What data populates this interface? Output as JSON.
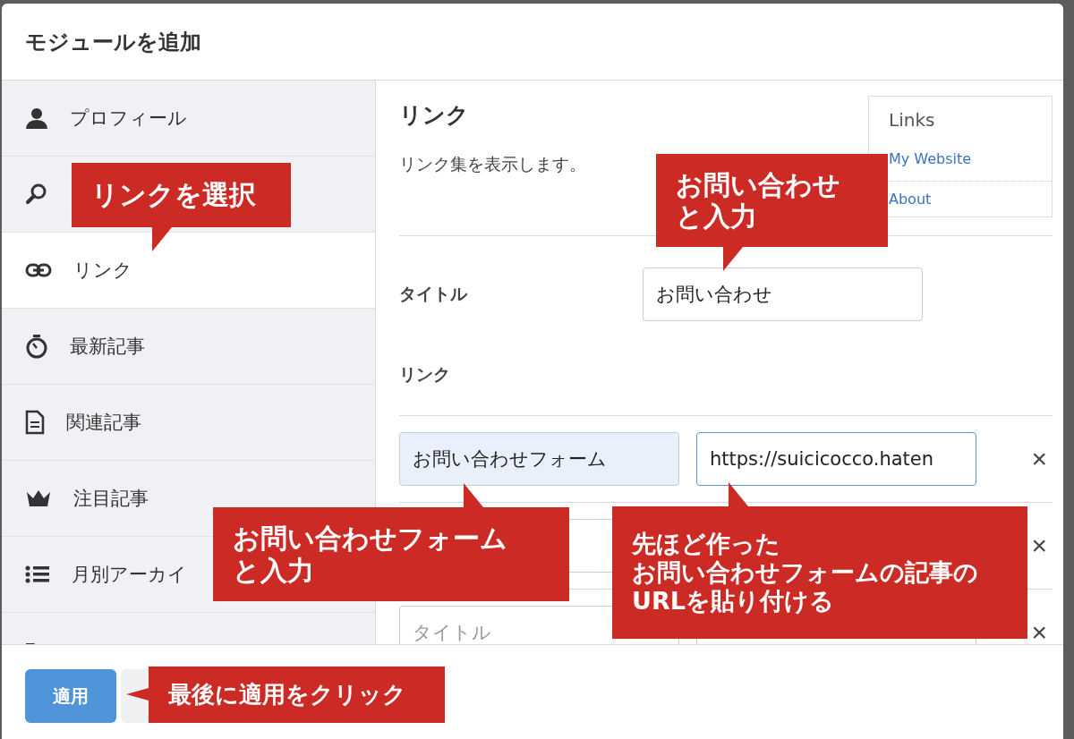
{
  "dialog": {
    "title": "モジュールを追加"
  },
  "sidebar": {
    "items": [
      {
        "label": "プロフィール",
        "selected": false
      },
      {
        "selected": false
      },
      {
        "label": "リンク",
        "selected": true
      },
      {
        "label": "最新記事",
        "selected": false
      },
      {
        "label": "関連記事",
        "selected": false
      },
      {
        "label": "注目記事",
        "selected": false
      },
      {
        "label": "月別アーカイ",
        "selected": false
      },
      {
        "selected": false
      }
    ]
  },
  "module": {
    "title": "リンク",
    "description": "リンク集を表示します。",
    "preview": {
      "heading": "Links",
      "links": [
        "My Website",
        "About"
      ]
    },
    "title_field": {
      "label": "タイトル",
      "value": "お問い合わせ"
    },
    "links_label": "リンク",
    "rows": [
      {
        "kind": "pair",
        "title": "お問い合わせフォーム",
        "url": "https://suicicocco.haten",
        "remove": "×"
      },
      {
        "kind": "single",
        "remove": "×"
      },
      {
        "kind": "pair",
        "title_placeholder": "タイトル",
        "remove": "×"
      }
    ]
  },
  "footer": {
    "buttons": [
      {
        "label": "適用",
        "kind": "primary"
      },
      {
        "kind": "secondary"
      }
    ]
  },
  "callouts": [
    {
      "lines": [
        "リンクを選択"
      ],
      "kind": "down"
    },
    {
      "lines": [
        "お問い合わせ",
        "と入力"
      ],
      "kind": "down"
    },
    {
      "lines": [
        "お問い合わせフォーム",
        "と入力"
      ],
      "kind": "up"
    },
    {
      "lines": [
        "先ほど作った",
        "お問い合わせフォームの記事の",
        "URLを貼り付ける"
      ],
      "kind": "up"
    },
    {
      "lines": [
        "最後に適用をクリック"
      ],
      "kind": "left"
    }
  ]
}
